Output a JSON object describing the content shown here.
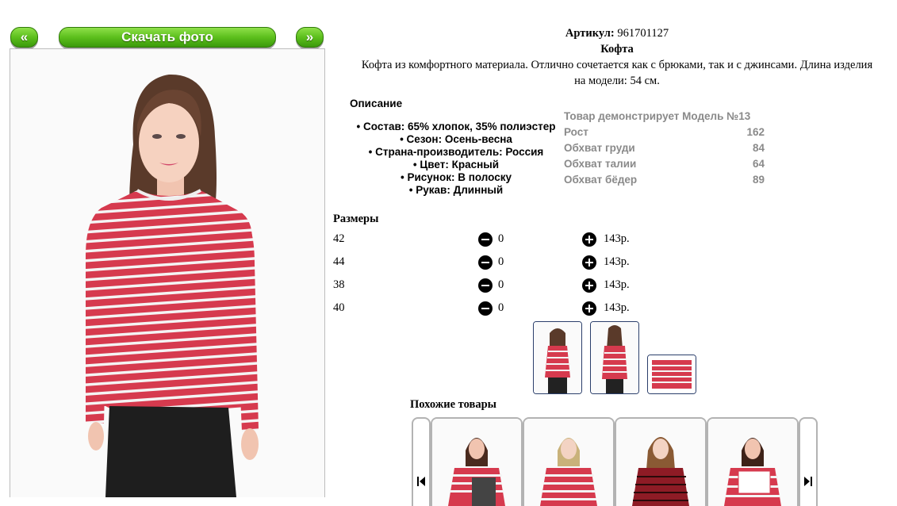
{
  "nav": {
    "prev_label": "«",
    "download_label": "Скачать фото",
    "next_label": "»"
  },
  "product": {
    "article_label": "Артикул:",
    "article_value": "961701127",
    "name": "Кофта",
    "description_line1": "Кофта из комфортного материала. Отлично сочетается как с брюками, так и с джинсами. Длина изделия",
    "description_line2": "на модели: 54 см."
  },
  "description": {
    "heading": "Описание",
    "items": [
      "Состав: 65% хлопок, 35% полиэстер",
      "Сезон: Осень-весна",
      "Страна-производитель: Россия",
      "Цвет: Красный",
      "Рисунок: В полоску",
      "Рукав: Длинный"
    ]
  },
  "model": {
    "title": "Товар демонстрирует Модель №13",
    "params": [
      {
        "label": "Рост",
        "value": "162"
      },
      {
        "label": "Обхват груди",
        "value": "84"
      },
      {
        "label": "Обхват талии",
        "value": "64"
      },
      {
        "label": "Обхват бёдер",
        "value": "89"
      }
    ]
  },
  "sizes": {
    "heading": "Размеры",
    "rows": [
      {
        "size": "42",
        "qty": "0",
        "price": "143р."
      },
      {
        "size": "44",
        "qty": "0",
        "price": "143р."
      },
      {
        "size": "38",
        "qty": "0",
        "price": "143р."
      },
      {
        "size": "40",
        "qty": "0",
        "price": "143р."
      }
    ]
  },
  "similar": {
    "heading": "Похожие товары"
  },
  "colors": {
    "stripe_red": "#d63a4e",
    "stripe_white": "#f4f4f4",
    "button_green": "#5cbf1c",
    "thumb_border": "#2b3f6b"
  }
}
